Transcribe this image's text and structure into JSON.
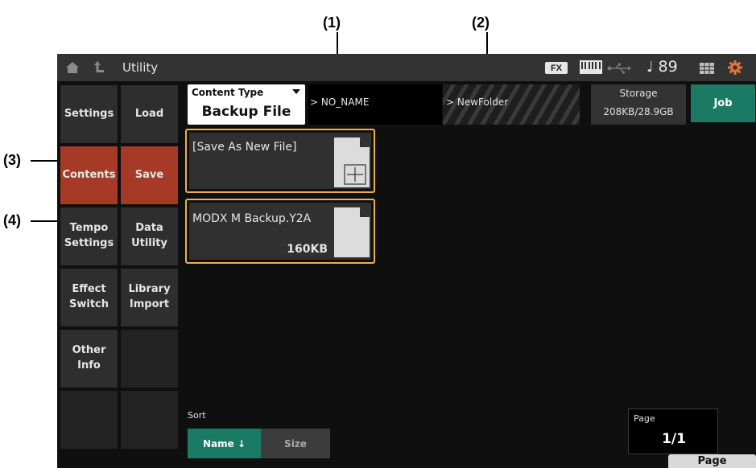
{
  "callouts": [
    "(1)",
    "(2)",
    "(3)",
    "(4)"
  ],
  "header": {
    "title": "Utility",
    "fx_badge": "FX",
    "tempo": "89"
  },
  "nav": {
    "col1": [
      "Settings",
      "Contents",
      "Tempo\nSettings",
      "Effect\nSwitch",
      "Other\nInfo"
    ],
    "col2": [
      "Load",
      "Save",
      "Data\nUtility",
      "Library\nImport"
    ],
    "selected": [
      "Contents",
      "Save"
    ]
  },
  "content_type": {
    "label": "Content Type",
    "value": "Backup File"
  },
  "path": {
    "current": "> NO_NAME",
    "folder": "> NewFolder"
  },
  "storage": {
    "label": "Storage",
    "value": "208KB/28.9GB"
  },
  "job_label": "Job",
  "files": [
    {
      "name": "[Save As New File]",
      "size": ""
    },
    {
      "name": "MODX M Backup.Y2A",
      "size": "160KB"
    }
  ],
  "sort": {
    "label": "Sort",
    "options": [
      "Name ↓",
      "Size"
    ],
    "selected": "Name ↓"
  },
  "page": {
    "label": "Page",
    "value": "1/1",
    "button": "Page"
  },
  "colors": {
    "accent_teal": "#1b7a63",
    "selected_red": "#a63a26",
    "highlight_orange": "#ecb14a",
    "settings_icon": "#e8723a"
  }
}
